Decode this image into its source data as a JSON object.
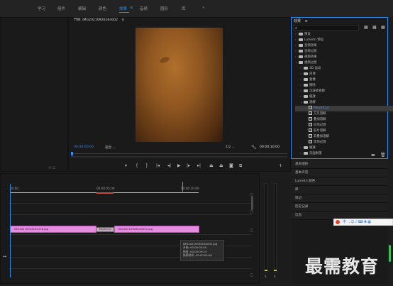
{
  "workspace_tabs": [
    "学习",
    "组件",
    "编辑",
    "颜色",
    "效果",
    "音频",
    "图形",
    "库",
    "»"
  ],
  "active_workspace": "效果",
  "colors": {
    "accent": "#2d8ceb",
    "clip": "#e58be0",
    "inout": "#d9c33a"
  },
  "program_monitor": {
    "title": "节目: IMG20210926164002",
    "menu_icon": "≡",
    "timecode_left": "00:00:00:00",
    "fit_label": "适合",
    "resolution": "1/2",
    "timecode_right": "00:00:10:00"
  },
  "transport_icons": [
    "marker-icon",
    "in-icon",
    "out-icon",
    "go-in-icon",
    "step-back-icon",
    "play-icon",
    "step-fwd-icon",
    "go-out-icon",
    "lift-icon",
    "extract-icon",
    "camera-icon",
    "export-icon",
    "add-icon"
  ],
  "effects_panel": {
    "title": "效果",
    "menu_icon": "≡",
    "search_icon": "⌕",
    "items": [
      {
        "label": "预设",
        "level": 0,
        "kind": "folder",
        "open": false
      },
      {
        "label": "Lumetri 预设",
        "level": 0,
        "kind": "folder",
        "open": false
      },
      {
        "label": "音频效果",
        "level": 0,
        "kind": "folder",
        "open": false
      },
      {
        "label": "音频过渡",
        "level": 0,
        "kind": "folder",
        "open": false
      },
      {
        "label": "视频效果",
        "level": 0,
        "kind": "folder",
        "open": false
      },
      {
        "label": "视频过渡",
        "level": 0,
        "kind": "folder",
        "open": true
      },
      {
        "label": "3D 运动",
        "level": 1,
        "kind": "folder",
        "open": false
      },
      {
        "label": "内滑",
        "level": 1,
        "kind": "folder",
        "open": false
      },
      {
        "label": "划像",
        "level": 1,
        "kind": "folder",
        "open": false
      },
      {
        "label": "擦除",
        "level": 1,
        "kind": "folder",
        "open": false
      },
      {
        "label": "沉浸式视频",
        "level": 1,
        "kind": "folder",
        "open": false
      },
      {
        "label": "缩放",
        "level": 1,
        "kind": "folder",
        "open": false
      },
      {
        "label": "溶解",
        "level": 1,
        "kind": "folder",
        "open": true
      },
      {
        "label": "MorphCut",
        "level": 2,
        "kind": "effect",
        "selected": true
      },
      {
        "label": "交叉溶解",
        "level": 2,
        "kind": "effect"
      },
      {
        "label": "叠加溶解",
        "level": 2,
        "kind": "effect"
      },
      {
        "label": "白场过渡",
        "level": 2,
        "kind": "effect"
      },
      {
        "label": "胶片溶解",
        "level": 2,
        "kind": "effect"
      },
      {
        "label": "非叠加溶解",
        "level": 2,
        "kind": "effect"
      },
      {
        "label": "黑场过渡",
        "level": 2,
        "kind": "effect"
      },
      {
        "label": "缩放",
        "level": 1,
        "kind": "folder",
        "open": false
      },
      {
        "label": "页面剥落",
        "level": 1,
        "kind": "folder",
        "open": false
      }
    ]
  },
  "right_panels": [
    "基本图形",
    "基本声音",
    "Lumetri 颜色",
    "库",
    "标记",
    "历史记录",
    "信息"
  ],
  "timeline": {
    "ruler_labels": [
      "00:00",
      "00:00:05:00",
      "00:00:10:00"
    ],
    "clip1_label": "IMG20210926164156.jpg",
    "clip2_label": "IMG20210926164002.jpg",
    "transition_label": "MorphCut",
    "tooltip": {
      "name": "IMG20210926164002.jpg",
      "start": "开始: 00:00:05:00",
      "end": "结束: 00:00:09:24",
      "duration": "持续时间: 00:00:05:00"
    }
  },
  "audio_meter": {
    "labels": [
      "S",
      "S"
    ]
  },
  "ime": {
    "text": "中·,☺♪⌨♣▦"
  },
  "watermark": "最需教育"
}
